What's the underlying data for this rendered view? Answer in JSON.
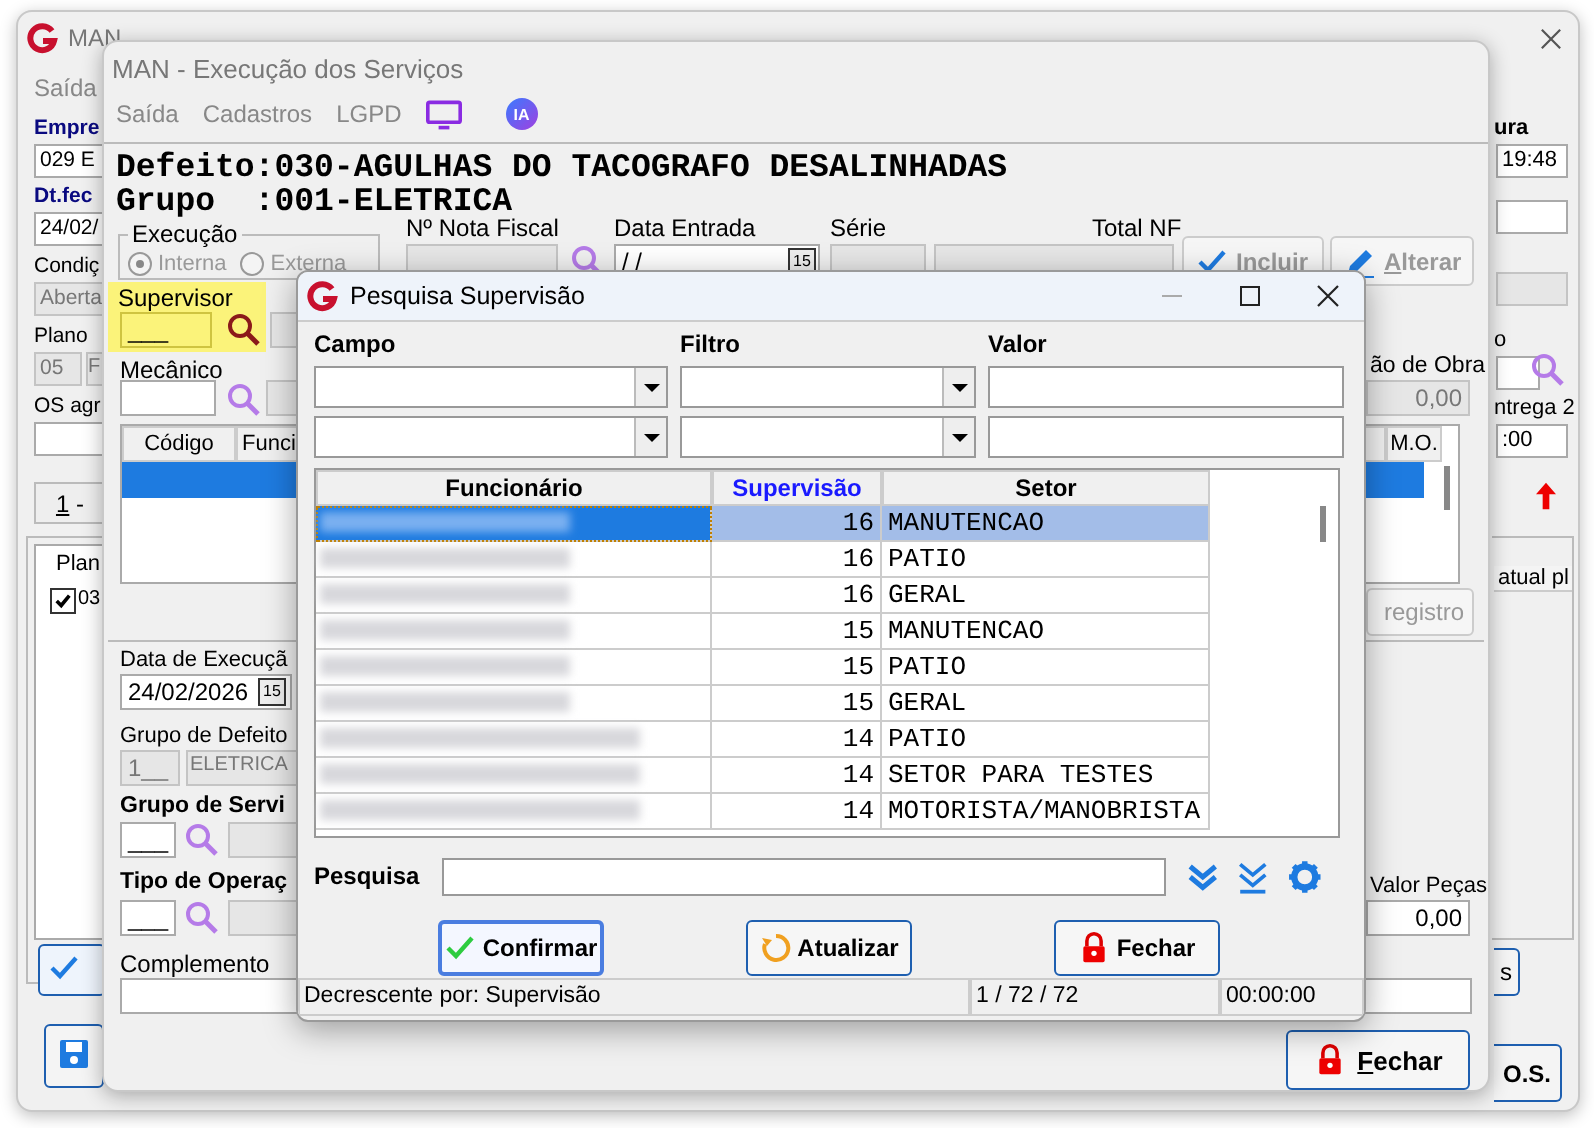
{
  "back_window": {
    "title": "MAN",
    "menu": [
      "Saída"
    ],
    "left_form": [
      {
        "label": "Empre",
        "bold": true,
        "values": [
          "029 E"
        ],
        "disabled": false
      },
      {
        "label": "Dt.fec",
        "bold": true,
        "values": [
          "24/02/"
        ],
        "disabled": false
      },
      {
        "label": "Condiç",
        "bold": false,
        "values": [
          "Aberta"
        ],
        "disabled": true
      },
      {
        "label": "Plano",
        "bold": false,
        "values": [
          "05",
          "F"
        ],
        "disabled": true
      },
      {
        "label": "OS agr",
        "bold": false,
        "disabled": false
      }
    ],
    "tab_button": "1 -",
    "plan_list": {
      "header": "Plan",
      "items": [
        {
          "label": "03",
          "checked": true
        }
      ]
    },
    "right_form": [
      {
        "label": "ura",
        "bold": true,
        "value": "19:48",
        "disabled": false
      },
      {
        "disabled": false
      },
      {
        "disabled": true
      },
      {
        "label": "o",
        "bold": false,
        "disabled": false
      },
      {
        "label": "ntrega 2",
        "bold": false,
        "value": ":00",
        "disabled": false
      }
    ],
    "right_header": "atual pl",
    "side_button": "s",
    "os_button": "O.S."
  },
  "main_window": {
    "title": "MAN - Execução dos Serviços",
    "menu": [
      "Saída",
      "Cadastros",
      "LGPD"
    ],
    "ia_badge": "IA",
    "heading": [
      "Defeito:030-AGULHAS DO TACOGRAFO DESALINHADAS",
      "Grupo  :001-ELETRICA"
    ],
    "execucao": {
      "legend": "Execução",
      "options": [
        {
          "label": "Interna",
          "selected": true,
          "disabled": true
        },
        {
          "label": "Externa",
          "selected": false,
          "disabled": true
        }
      ]
    },
    "nota_fiscal": {
      "label": "Nº Nota Fiscal"
    },
    "data_entrada": {
      "label": "Data Entrada",
      "value": "/ /",
      "calendar_day": "15"
    },
    "serie": {
      "label": "Série"
    },
    "total_nf": {
      "label": "Total NF"
    },
    "actions": [
      {
        "label": "Incluir",
        "kind": "check",
        "disabled": true
      },
      {
        "label": "Alterar",
        "kind": "pencil",
        "disabled": true
      }
    ],
    "supervisor": {
      "label": "Supervisor",
      "value": "___",
      "highlighted": true
    },
    "mecanico": {
      "label": "Mecânico"
    },
    "grid": {
      "columns": [
        "Código",
        "Funci",
        "M.O."
      ],
      "rows": [
        {
          "selected": true
        }
      ]
    },
    "mao_de_obra": {
      "label": "ão de Obra",
      "value": "0,00"
    },
    "registro_button": {
      "label": "registro",
      "disabled": true
    },
    "data_execucao": {
      "label": "Data de Execuçã",
      "value": "24/02/2026",
      "calendar_day": "15"
    },
    "grupo_defeito": {
      "label": "Grupo de Defeito",
      "code": "1__",
      "name": "ELETRICA"
    },
    "grupo_servico": {
      "label": "Grupo de Servi",
      "value": "___"
    },
    "tipo_operacao": {
      "label": "Tipo de Operaç",
      "value": "___"
    },
    "complemento": {
      "label": "Complemento"
    },
    "valor_pecas": {
      "label": "Valor Peças",
      "value": "0,00"
    },
    "fechar_button": {
      "label": "Fechar"
    }
  },
  "dialog": {
    "title": "Pesquisa Supervisão",
    "filter_labels": [
      "Campo",
      "Filtro",
      "Valor"
    ],
    "table": {
      "columns": [
        {
          "label": "Funcionário",
          "sorted": false
        },
        {
          "label": "Supervisão",
          "sorted": true
        },
        {
          "label": "Setor",
          "sorted": false
        }
      ],
      "rows": [
        {
          "supervisao": "16",
          "setor": "MANUTENCAO",
          "selected": true
        },
        {
          "supervisao": "16",
          "setor": "PATIO",
          "selected": false
        },
        {
          "supervisao": "16",
          "setor": "GERAL",
          "selected": false
        },
        {
          "supervisao": "15",
          "setor": "MANUTENCAO",
          "selected": false
        },
        {
          "supervisao": "15",
          "setor": "PATIO",
          "selected": false
        },
        {
          "supervisao": "15",
          "setor": "GERAL",
          "selected": false
        },
        {
          "supervisao": "14",
          "setor": "PATIO",
          "selected": false
        },
        {
          "supervisao": "14",
          "setor": "SETOR PARA TESTES",
          "selected": false
        },
        {
          "supervisao": "14",
          "setor": "MOTORISTA/MANOBRISTA",
          "selected": false
        }
      ]
    },
    "search_label": "Pesquisa",
    "buttons": [
      {
        "label": "Confirmar",
        "kind": "confirm",
        "default": true
      },
      {
        "label": "Atualizar",
        "kind": "refresh",
        "default": false
      },
      {
        "label": "Fechar",
        "kind": "close",
        "default": false
      }
    ],
    "status": [
      "Decrescente por: Supervisão",
      "1 / 72 / 72",
      "00:00:00"
    ]
  }
}
